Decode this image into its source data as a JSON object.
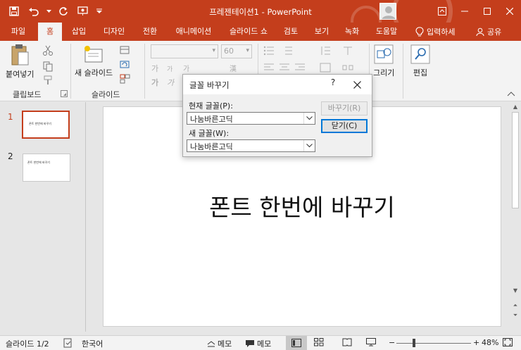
{
  "window": {
    "title": "프레젠테이션1  -  PowerPoint"
  },
  "tabs": [
    {
      "label": "파일"
    },
    {
      "label": "홈"
    },
    {
      "label": "삽입"
    },
    {
      "label": "디자인"
    },
    {
      "label": "전환"
    },
    {
      "label": "애니메이션"
    },
    {
      "label": "슬라이드 쇼"
    },
    {
      "label": "검토"
    },
    {
      "label": "보기"
    },
    {
      "label": "녹화"
    },
    {
      "label": "도움말"
    }
  ],
  "tab_right": {
    "tell_me": "입력하세",
    "share": "공유"
  },
  "ribbon": {
    "paste_label": "붙여넣기",
    "new_slide_label": "새 슬라이드",
    "clipboard_group": "클립보드",
    "slides_group": "슬라이드",
    "font_size": "60",
    "drawing_label": "그리기",
    "editing_label": "편집"
  },
  "slides": [
    {
      "number": "1",
      "thumb_text": "폰트 한번에 바꾸기"
    },
    {
      "number": "2",
      "thumb_text": "폰트 한번에 바꾸기"
    }
  ],
  "current_slide": {
    "title": "폰트 한번에 바꾸기"
  },
  "dialog": {
    "title": "글꼴 바꾸기",
    "help": "?",
    "current_font_label": "현재 글꼴(P):",
    "current_font_value": "나눔바른고딕",
    "new_font_label": "새 글꼴(W):",
    "new_font_value": "나눔바른고딕",
    "replace_button": "바꾸기(R)",
    "close_button": "닫기(C)"
  },
  "status": {
    "slide_indicator": "슬라이드 1/2",
    "language": "한국어",
    "notes": "메모",
    "comments": "메모",
    "zoom": "48%"
  },
  "colors": {
    "accent": "#c43e1c",
    "ribbon_bg": "#f3f3f3",
    "dialog_default": "#0078d7"
  }
}
